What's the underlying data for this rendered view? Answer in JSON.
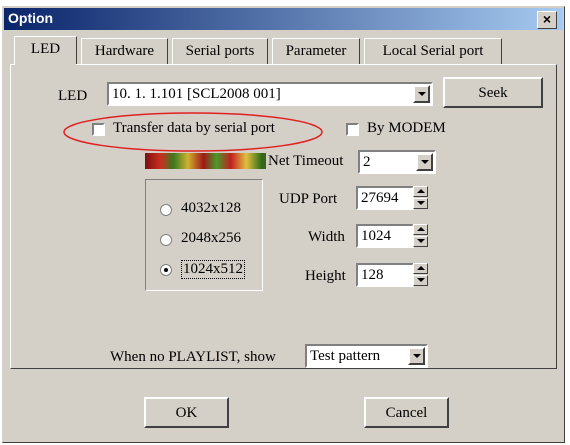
{
  "window": {
    "title": "Option",
    "close": "×"
  },
  "tabs": [
    "LED",
    "Hardware",
    "Serial ports",
    "Parameter",
    "Local Serial port"
  ],
  "led": {
    "label": "LED",
    "selected": "10.  1.  1.101 [SCL2008 001]",
    "seek": "Seek"
  },
  "options": {
    "transfer_serial": "Transfer data by serial port",
    "by_modem": "By MODEM"
  },
  "resolutions": {
    "items": [
      "4032x128",
      "2048x256",
      "1024x512"
    ],
    "selected": "1024x512"
  },
  "fields": {
    "net_timeout_label": "Net Timeout",
    "net_timeout": "2",
    "udp_port_label": "UDP Port",
    "udp_port": "27694",
    "width_label": "Width",
    "width": "1024",
    "height_label": "Height",
    "height": "128"
  },
  "playlist": {
    "label": "When no PLAYLIST, show",
    "selected": "Test pattern"
  },
  "buttons": {
    "ok": "OK",
    "cancel": "Cancel"
  },
  "colors": {
    "titlebar_start": "#0a246a",
    "titlebar_end": "#a6caf0",
    "face": "#d4d0c8",
    "highlight_ellipse": "#e02020"
  }
}
